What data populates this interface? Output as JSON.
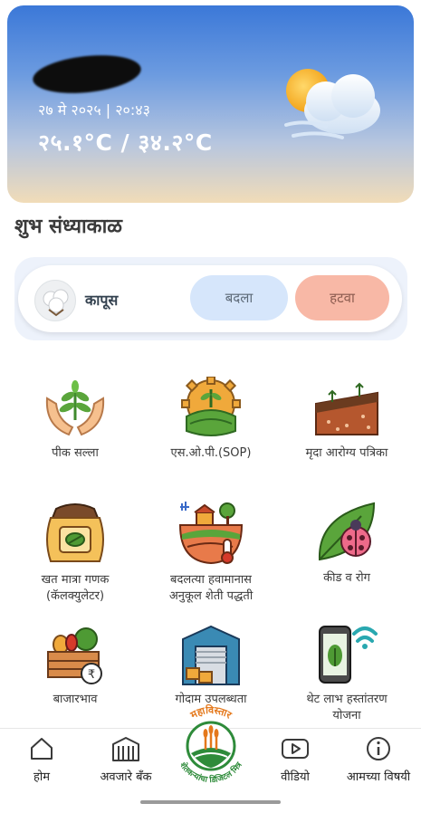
{
  "weather": {
    "location": "",
    "datetime": "२७ मे २०२५ | २०:४३",
    "temperature": "२५.१°C / ३४.२°C",
    "icon": "partly-cloudy-windy-icon"
  },
  "greeting": "शुभ संध्याकाळ",
  "crop": {
    "name": "कापूस",
    "icon": "cotton-icon",
    "change_label": "बदला",
    "remove_label": "हटवा"
  },
  "tiles": [
    {
      "label": "पीक सल्ला",
      "icon": "hands-plant-icon"
    },
    {
      "label": "एस.ओ.पी.(SOP)",
      "icon": "farm-gear-icon"
    },
    {
      "label": "मृदा आरोग्य पत्रिका",
      "icon": "soil-layers-icon"
    },
    {
      "label": "खत मात्रा गणक",
      "label2": "(कॅलक्युलेटर)",
      "icon": "fertilizer-sack-icon"
    },
    {
      "label": "बदलत्या हवामानास",
      "label2": "अनुकूल शेती पद्धती",
      "icon": "climate-farm-icon"
    },
    {
      "label": "कीड व रोग",
      "icon": "ladybug-leaf-icon"
    },
    {
      "label": "बाजारभाव",
      "icon": "vegetable-crate-rupee-icon"
    },
    {
      "label": "गोदाम उपलब्धता",
      "icon": "warehouse-icon"
    },
    {
      "label": "थेट लाभ हस्तांतरण",
      "label2": "योजना",
      "icon": "phone-transfer-icon"
    }
  ],
  "nav": {
    "home": "होम",
    "tools_bank": "अवजारे बँक",
    "logo_top": "महाविस्तार",
    "logo_bottom": "शेतकऱ्यांचा डिजिटल मित्र",
    "videos": "वीडियो",
    "about": "आमच्या विषयी"
  },
  "colors": {
    "change_button": "#d6e6fb",
    "remove_button": "#f8b8a6",
    "logo_orange": "#e4781b",
    "logo_green": "#2e8b3a"
  }
}
